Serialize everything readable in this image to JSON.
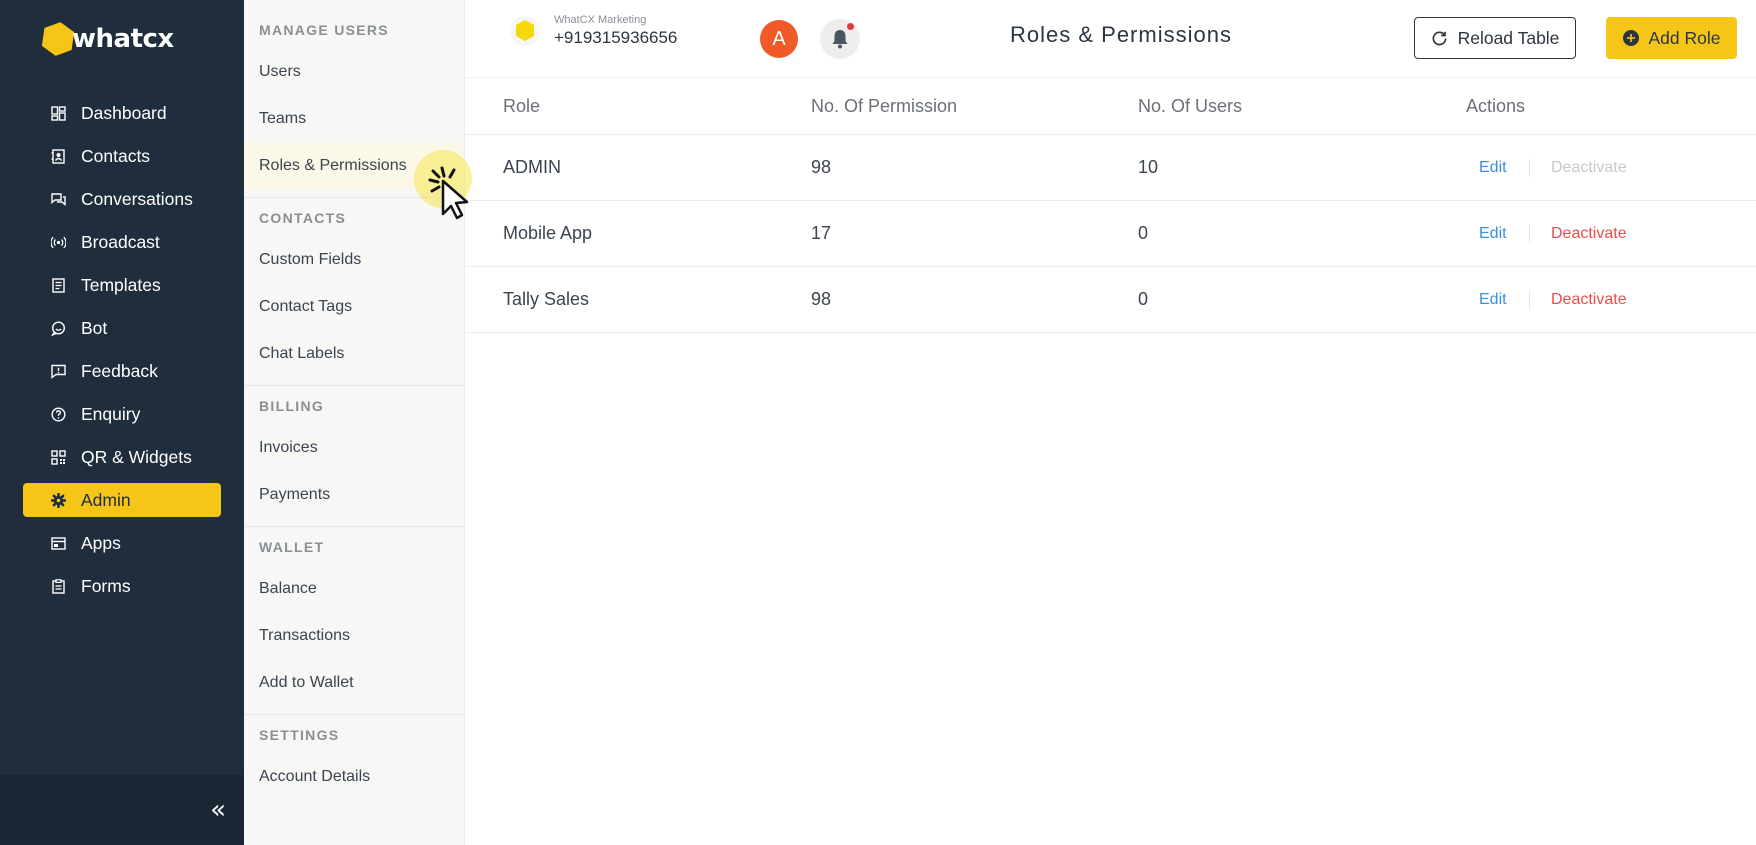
{
  "app": {
    "brand": "whatcx",
    "brand_color": "#f5c518",
    "sidebar_color": "#1f2d3d"
  },
  "sidebar": {
    "items": [
      {
        "label": "Dashboard",
        "icon": "dashboard-icon"
      },
      {
        "label": "Contacts",
        "icon": "contacts-icon"
      },
      {
        "label": "Conversations",
        "icon": "conversations-icon"
      },
      {
        "label": "Broadcast",
        "icon": "broadcast-icon"
      },
      {
        "label": "Templates",
        "icon": "templates-icon"
      },
      {
        "label": "Bot",
        "icon": "bot-icon"
      },
      {
        "label": "Feedback",
        "icon": "feedback-icon"
      },
      {
        "label": "Enquiry",
        "icon": "enquiry-icon"
      },
      {
        "label": "QR & Widgets",
        "icon": "qr-icon"
      },
      {
        "label": "Admin",
        "icon": "admin-gear-icon",
        "active": true
      },
      {
        "label": "Apps",
        "icon": "apps-icon"
      },
      {
        "label": "Forms",
        "icon": "forms-icon"
      }
    ],
    "collapse_icon": "collapse-chevrons-icon",
    "collapse_glyph": "«"
  },
  "subnav": {
    "sections": [
      {
        "title": "MANAGE USERS",
        "items": [
          "Users",
          "Teams",
          "Roles & Permissions"
        ]
      },
      {
        "title": "CONTACTS",
        "items": [
          "Custom Fields",
          "Contact Tags",
          "Chat Labels"
        ]
      },
      {
        "title": "BILLING",
        "items": [
          "Invoices",
          "Payments"
        ]
      },
      {
        "title": "WALLET",
        "items": [
          "Balance",
          "Transactions",
          "Add to Wallet"
        ]
      },
      {
        "title": "SETTINGS",
        "items": [
          "Account Details"
        ]
      }
    ],
    "active_item": "Roles & Permissions"
  },
  "header": {
    "account_name": "WhatCX Marketing",
    "account_phone": "+919315936656",
    "avatar_letter": "A",
    "avatar_color": "#ef5a28",
    "title": "Roles & Permissions",
    "reload_label": "Reload Table",
    "add_label": "Add Role"
  },
  "table": {
    "columns": [
      "Role",
      "No. Of Permission",
      "No. Of Users",
      "Actions"
    ],
    "rows": [
      {
        "role": "ADMIN",
        "permissions": "98",
        "users": "10",
        "edit": "Edit",
        "deactivate": "Deactivate",
        "deactivate_disabled": true
      },
      {
        "role": "Mobile App",
        "permissions": "17",
        "users": "0",
        "edit": "Edit",
        "deactivate": "Deactivate",
        "deactivate_disabled": false
      },
      {
        "role": "Tally Sales",
        "permissions": "98",
        "users": "0",
        "edit": "Edit",
        "deactivate": "Deactivate",
        "deactivate_disabled": false
      }
    ],
    "edit_color": "#3a8fe0",
    "deactivate_color": "#ef4a4a"
  }
}
